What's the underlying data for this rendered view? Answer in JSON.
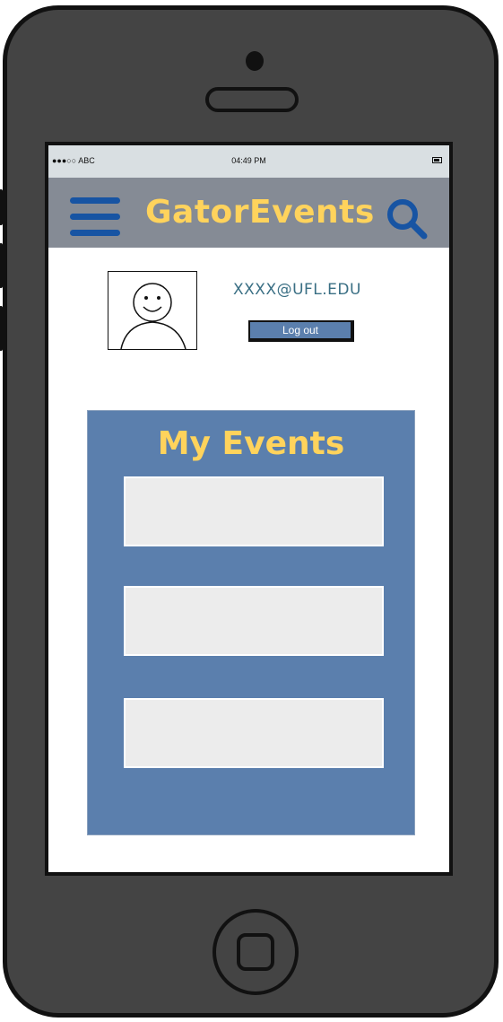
{
  "status_bar": {
    "carrier": "ABC",
    "time": "04:49 PM"
  },
  "navbar": {
    "menu_icon": "hamburger-menu-icon",
    "title": "GatorEvents",
    "search_icon": "search-icon"
  },
  "profile": {
    "email": "XXXX@UFL.EDU",
    "logout_label": "Log out",
    "avatar_icon": "smiley-person-icon"
  },
  "events": {
    "title": "My Events",
    "items": [
      "",
      "",
      ""
    ]
  },
  "colors": {
    "nav_bg": "#858b95",
    "accent_yellow": "#ffd35c",
    "icon_blue": "#1754a3",
    "panel_blue": "#5b7fad",
    "email_color": "#3a6f84"
  }
}
